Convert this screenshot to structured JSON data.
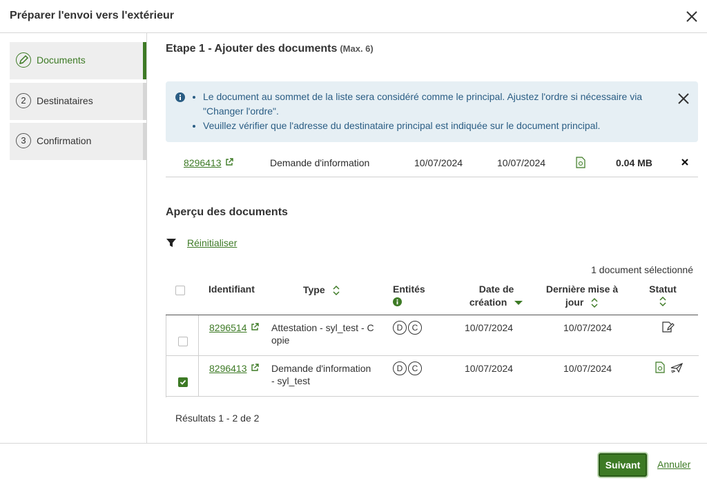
{
  "dialog": {
    "title": "Préparer l'envoi vers l'extérieur"
  },
  "steps": [
    {
      "number": "",
      "label": "Documents",
      "active": true
    },
    {
      "number": "2",
      "label": "Destinataires",
      "active": false
    },
    {
      "number": "3",
      "label": "Confirmation",
      "active": false
    }
  ],
  "step1": {
    "title": "Etape 1 - Ajouter des documents",
    "max": "(Max. 6)"
  },
  "info": {
    "line1a": "Le document au sommet de la liste sera considéré comme le principal. Ajustez l'ordre si nécessaire via",
    "line1b": "\"Changer l'ordre\".",
    "line2": "Veuillez vérifier que l'adresse du destinataire principal est indiquée sur le document principal."
  },
  "selected": {
    "id": "8296413",
    "type": "Demande d'information",
    "date1": "10/07/2024",
    "date2": "10/07/2024",
    "size": "0.04 MB"
  },
  "apercu": {
    "title": "Aperçu des documents",
    "reset": "Réinitialiser",
    "selected_count": "1 document sélectionné",
    "headers": {
      "id": "Identifiant",
      "type": "Type",
      "entites": "Entités",
      "date_creation_1": "Date de",
      "date_creation_2": "création",
      "maj_1": "Dernière mise à",
      "maj_2": "jour",
      "statut": "Statut"
    },
    "rows": [
      {
        "id": "8296514",
        "type_1": "Attestation - syl_test - C",
        "type_2": "opie",
        "ent1": "D",
        "ent2": "C",
        "created": "10/07/2024",
        "updated": "10/07/2024",
        "checked": false,
        "status_icon": "edit-document-icon"
      },
      {
        "id": "8296413",
        "type_1": "Demande d'information",
        "type_2": "- syl_test",
        "ent1": "D",
        "ent2": "C",
        "created": "10/07/2024",
        "updated": "10/07/2024",
        "checked": true,
        "status_icon": "sent-icon"
      }
    ],
    "results": "Résultats 1 - 2 de 2"
  },
  "footer": {
    "next": "Suivant",
    "cancel": "Annuler"
  },
  "colors": {
    "accent": "#3d7a25",
    "info_bg": "#e6eff4",
    "info_text": "#2a5d84"
  }
}
